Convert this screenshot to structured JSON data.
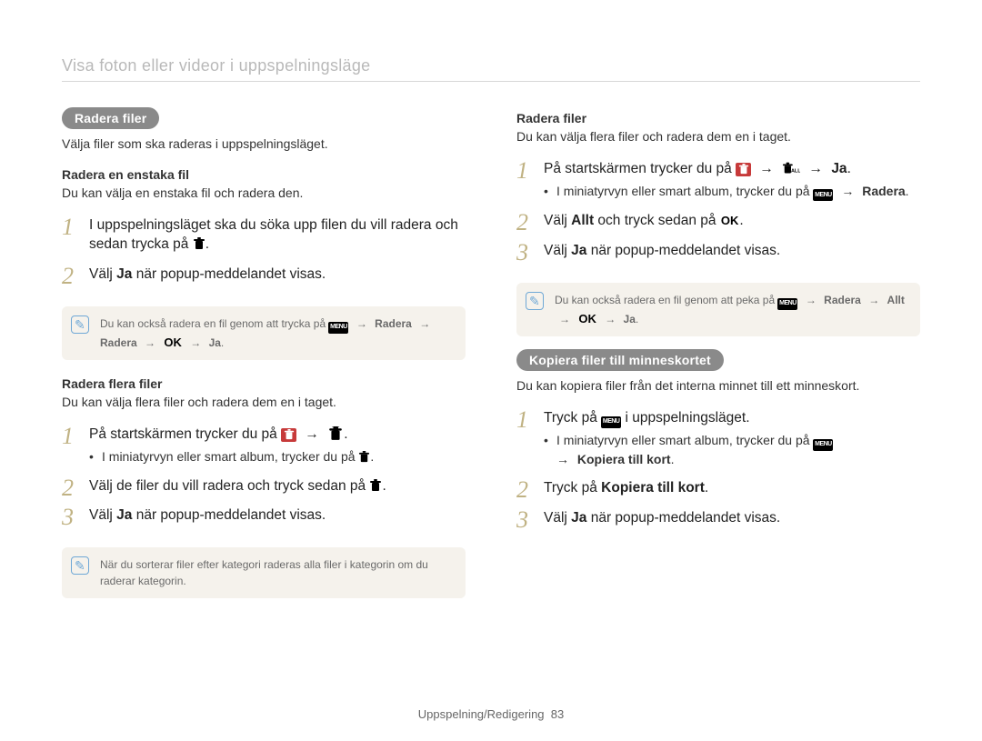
{
  "header": "Visa foton eller videor i uppspelningsläge",
  "left": {
    "pill": "Radera filer",
    "intro": "Välja filer som ska raderas i uppspelningsläget.",
    "sec1": {
      "head": "Radera en enstaka fil",
      "intro": "Du kan välja en enstaka fil och radera den.",
      "step1a": "I uppspelningsläget ska du söka upp filen du vill radera och sedan trycka på ",
      "step1b": ".",
      "step2a": "Välj ",
      "step2b": "Ja",
      "step2c": " när popup-meddelandet visas.",
      "note_a": "Du kan också radera en fil genom att trycka på ",
      "note_b": "Radera",
      "note_c": "Radera",
      "note_d": "Ja",
      "arrow": "→"
    },
    "sec2": {
      "head": "Radera flera filer",
      "intro": "Du kan välja flera filer och radera dem en i taget.",
      "step1a": "På startskärmen trycker du på ",
      "step1b": ".",
      "bullet1a": "I miniatyrvyn eller smart album, trycker du på ",
      "bullet1b": ".",
      "step2a": "Välj de filer du vill radera och tryck sedan på ",
      "step2b": ".",
      "step3a": "Välj ",
      "step3b": "Ja",
      "step3c": " när popup-meddelandet visas.",
      "note": "När du sorterar filer efter kategori raderas alla filer i kategorin om du raderar kategorin."
    }
  },
  "right": {
    "sec1": {
      "head": "Radera filer",
      "intro": "Du kan välja flera filer och radera dem en i taget.",
      "step1a": "På startskärmen trycker du på ",
      "step1b": "Ja",
      "step1c": ".",
      "bullet_a": "I miniatyrvyn eller smart album, trycker du på ",
      "bullet_b": "Radera",
      "bullet_c": ".",
      "step2a": "Välj ",
      "step2b": "Allt",
      "step2c": " och tryck sedan på ",
      "step2d": ".",
      "step3a": "Välj ",
      "step3b": "Ja",
      "step3c": " när popup-meddelandet visas.",
      "note_a": "Du kan också radera en fil genom att peka på ",
      "note_b": "Radera",
      "note_c": "Allt",
      "note_d": "Ja"
    },
    "sec2": {
      "pill": "Kopiera filer till minneskortet",
      "intro": "Du kan kopiera filer från det interna minnet till ett minneskort.",
      "step1a": "Tryck på ",
      "step1b": " i uppspelningsläget.",
      "bullet_a": "I miniatyrvyn eller smart album, trycker du på ",
      "bullet_b": "Kopiera till kort",
      "bullet_c": ".",
      "step2a": "Tryck på ",
      "step2b": "Kopiera till kort",
      "step2c": ".",
      "step3a": "Välj ",
      "step3b": "Ja",
      "step3c": " när popup-meddelandet visas."
    }
  },
  "footer": {
    "section": "Uppspelning/Redigering",
    "page": "83"
  },
  "labels": {
    "menu": "MENU",
    "ok": "OK",
    "arrow": "→"
  }
}
